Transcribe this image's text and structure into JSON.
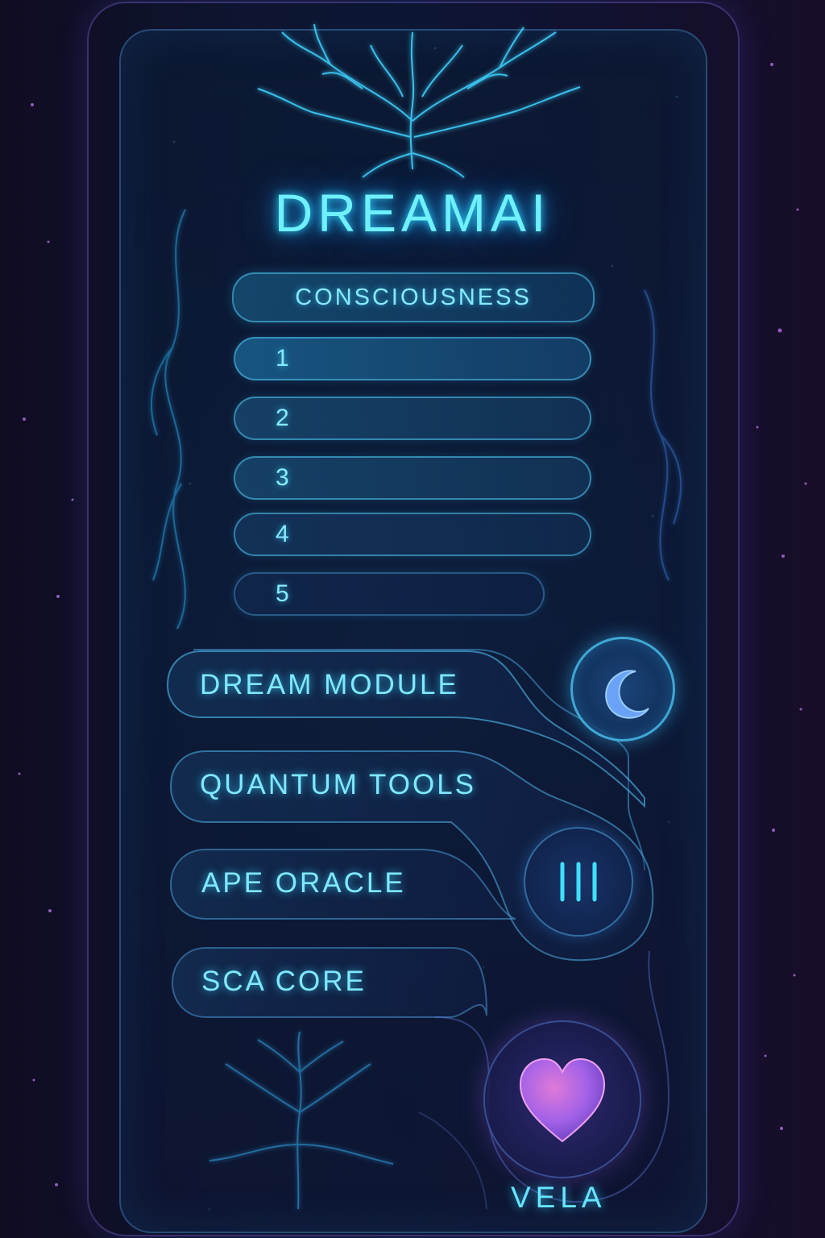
{
  "app": {
    "title": "DREAMAI"
  },
  "consciousness": {
    "header": "CONSCIOUSNESS",
    "levels": [
      "1",
      "2",
      "3",
      "4",
      "5"
    ]
  },
  "modules": {
    "dream_module": "DREAM MODULE",
    "quantum_tools": "QUANTUM TOOLS",
    "ape_oracle": "APE ORACLE",
    "sca_core": "SCA CORE"
  },
  "footer": {
    "label": "VELA"
  },
  "icons": {
    "moon": "moon-icon",
    "bars": "bars-icon",
    "heart": "heart-icon"
  },
  "colors": {
    "accent": "#6ff0ff",
    "background": "#0b0d1f",
    "heart": "#b060e8"
  }
}
